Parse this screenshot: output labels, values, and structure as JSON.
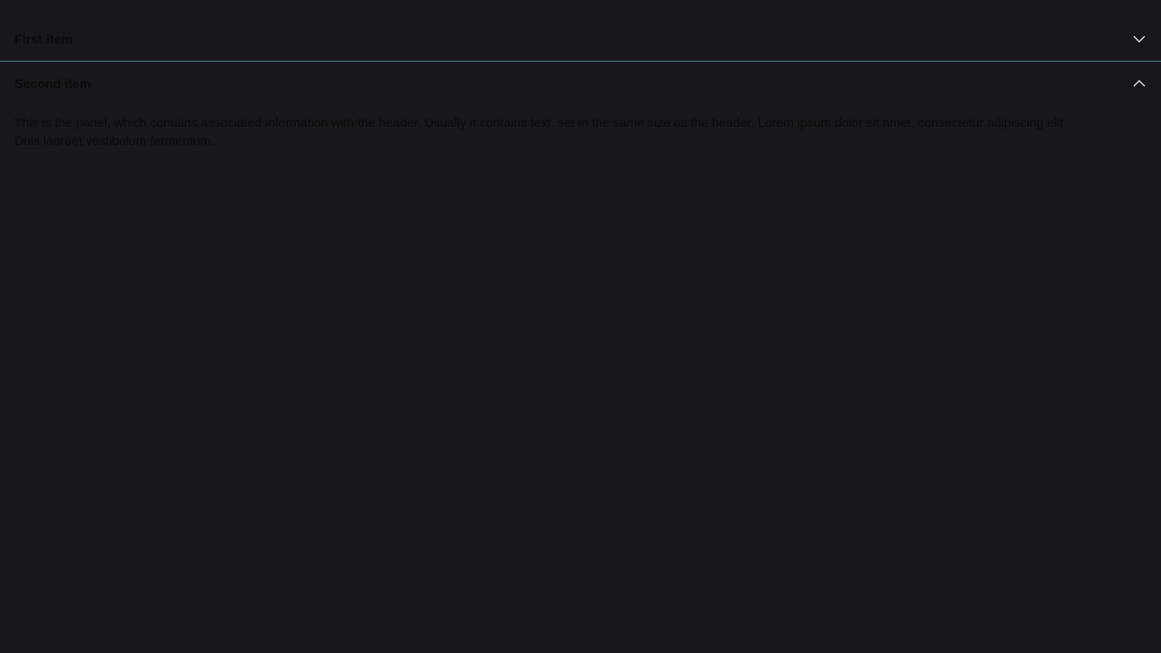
{
  "accordion": {
    "items": [
      {
        "title": "First item",
        "expanded": false,
        "icon": "chevron-down-icon"
      },
      {
        "title": "Second item",
        "expanded": true,
        "icon": "chevron-up-icon",
        "panel_text": "This is the panel, which contains associated information with the header. Usually it contains text, set in the same size as the header. Lorem ipsum dolor sit amet, consectetur adipiscing elit. Duis laoreet vestibulum fermentum."
      }
    ]
  },
  "colors": {
    "background": "#16181c",
    "text": "#0b0c0e",
    "divider": "#5f7d8a",
    "icon": "#e6e9ec"
  }
}
